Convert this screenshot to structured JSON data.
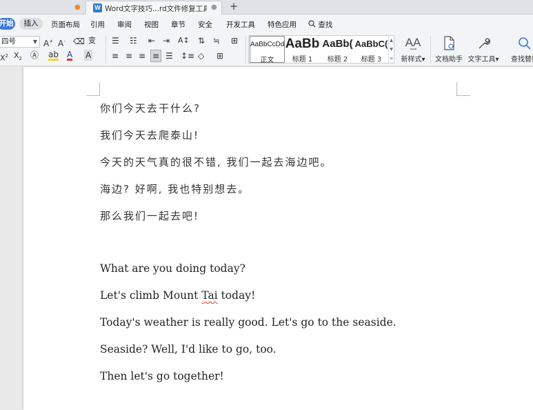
{
  "tabs": {
    "document_title": "Word文字技巧...rd文件修复工具",
    "plus": "+"
  },
  "menu": {
    "start": "开始",
    "insert": "插入",
    "items": [
      "页面布局",
      "引用",
      "审阅",
      "视图",
      "章节",
      "安全",
      "开发工具",
      "特色应用"
    ],
    "search": "查找"
  },
  "toolbar": {
    "font_size": "四号",
    "styles": [
      {
        "preview": "AaBbCcDd",
        "label": "正文"
      },
      {
        "preview": "AaBb",
        "label": "标题 1"
      },
      {
        "preview": "AaBb(",
        "label": "标题 2"
      },
      {
        "preview": "AaBbC(",
        "label": "标题 3"
      }
    ],
    "new_style": "新样式",
    "doc_assistant": "文档助手",
    "text_tools": "文字工具",
    "find_replace": "查找替换",
    "colors": {
      "accent": "#3d7be0",
      "font_color": "#e0312f",
      "highlight": "#f6d22c"
    }
  },
  "document": {
    "chinese_lines": [
      "你们今天去干什么?",
      "我们今天去爬泰山!",
      "今天的天气真的很不错, 我们一起去海边吧。",
      "海边? 好啊, 我也特别想去。",
      "那么我们一起去吧!"
    ],
    "english_lines": {
      "line1": "What are you doing today?",
      "line2_before": "Let's climb Mount ",
      "line2_flagged": "Tai",
      "line2_after": " today!",
      "line3": "Today's weather is really good. Let's go to the seaside.",
      "line4": "Seaside? Well, I'd like to go, too.",
      "line5": "Then let's go together!"
    }
  }
}
